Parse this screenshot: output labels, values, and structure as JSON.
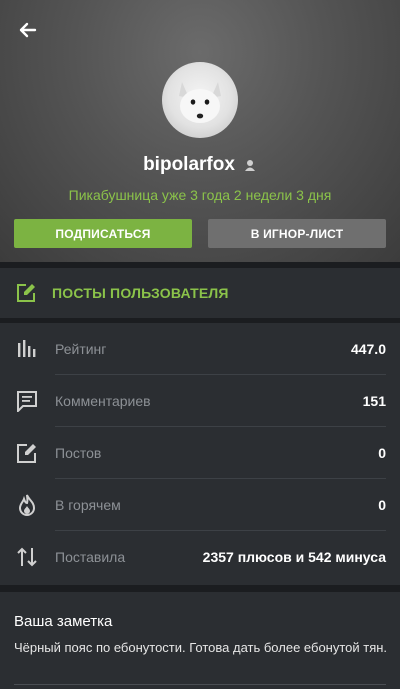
{
  "profile": {
    "username": "bipolarfox",
    "tenure": "Пикабушница уже 3 года 2 недели 3 дня",
    "subscribe_label": "ПОДПИСАТЬСЯ",
    "ignore_label": "В ИГНОР-ЛИСТ"
  },
  "posts_link": {
    "label": "ПОСТЫ ПОЛЬЗОВАТЕЛЯ"
  },
  "stats": [
    {
      "icon": "bar-chart-icon",
      "label": "Рейтинг",
      "value": "447.0"
    },
    {
      "icon": "comment-icon",
      "label": "Комментариев",
      "value": "151"
    },
    {
      "icon": "edit-icon",
      "label": "Постов",
      "value": "0"
    },
    {
      "icon": "flame-icon",
      "label": "В горячем",
      "value": "0"
    },
    {
      "icon": "sort-arrows-icon",
      "label": "Поставила",
      "value": "2357 плюсов и 542 минуса"
    }
  ],
  "note": {
    "title": "Ваша заметка",
    "text": "Чёрный пояс по ебонутости. Готова дать более ебонутой тян."
  },
  "colors": {
    "accent": "#8bc34a",
    "subscribe_button": "#7cb342",
    "ignore_button": "#6f6f6f",
    "panel": "#2b2e32",
    "background": "#1b1d20"
  }
}
